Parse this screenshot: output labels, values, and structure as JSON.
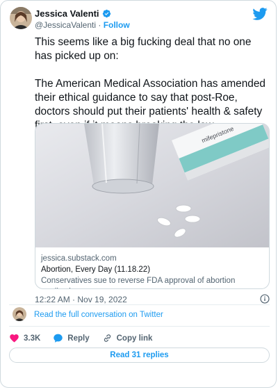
{
  "author": {
    "name": "Jessica Valenti",
    "handle": "@JessicaValenti",
    "separator": "·",
    "follow_label": "Follow"
  },
  "tweet": {
    "text": "This seems like a big fucking deal that no one has picked up on:\n\nThe American Medical Association has amended their ethical guidance to say that post-Roe, doctors should put their patients' health & safety first, even if it means breaking the law",
    "timestamp": "12:22 AM · Nov 19, 2022"
  },
  "link_card": {
    "domain": "jessica.substack.com",
    "title": "Abortion, Every Day (11.18.22)",
    "description": "Conservatives sue to reverse FDA approval of abortion medication"
  },
  "conversation_link": "Read the full conversation on Twitter",
  "actions": {
    "like_count": "3.3K",
    "reply_label": "Reply",
    "copy_label": "Copy link"
  },
  "read_replies_label": "Read 31 replies",
  "colors": {
    "accent": "#1d9bf0",
    "like": "#f91880",
    "muted": "#536471",
    "border": "#cfd9de"
  },
  "icons": [
    "verified-badge-icon",
    "twitter-bird-icon",
    "info-icon",
    "heart-icon",
    "reply-icon",
    "link-icon"
  ]
}
